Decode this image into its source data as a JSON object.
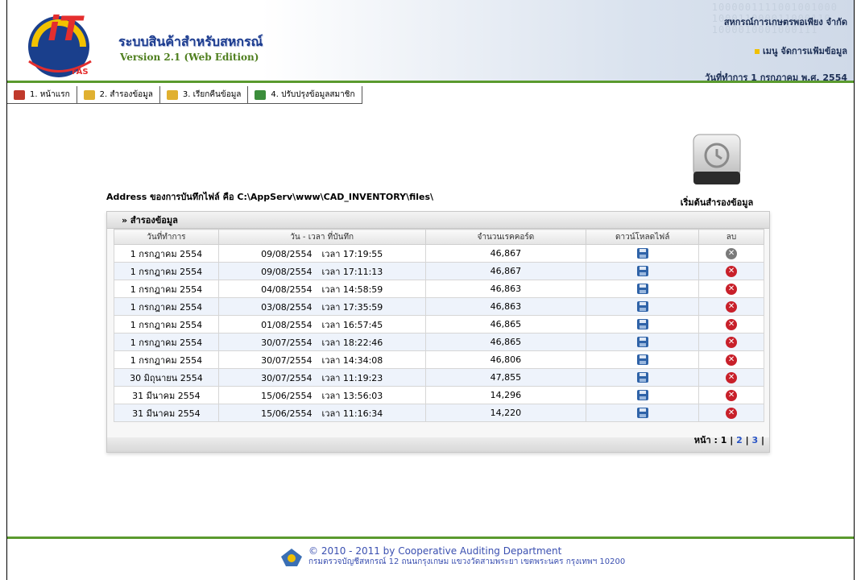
{
  "header": {
    "app_title": "ระบบสินค้าสำหรับสหกรณ์",
    "version": "Version 2.1 (Web Edition)",
    "coop_name": "สหกรณ์การเกษตรพอเพียง จำกัด",
    "user_line": "เมนู จัดการแฟ้มข้อมูล",
    "work_date": "วันที่ทำการ 1 กรกฎาคม พ.ศ. 2554",
    "faint_text": "1000001111001001000\n100011000011000110\n1000010001000111"
  },
  "menu": [
    {
      "label": "1. หน้าแรก",
      "icon": "home-icon",
      "color": "#c0392b"
    },
    {
      "label": "2. สำรองข้อมูล",
      "icon": "backup-icon",
      "color": "#e0b030"
    },
    {
      "label": "3. เรียกคืนข้อมูล",
      "icon": "restore-icon",
      "color": "#e0b030"
    },
    {
      "label": "4. ปรับปรุงข้อมูลสมาชิก",
      "icon": "members-icon",
      "color": "#3b8d3b"
    }
  ],
  "backup_button": {
    "label": "เริ่มต้นสำรองข้อมูล"
  },
  "address_line": "Address ของการบันทึกไฟล์ คือ C:\\AppServ\\www\\CAD_INVENTORY\\files\\",
  "panel": {
    "title": "» สำรองข้อมูล",
    "columns": [
      "วันที่ทำการ",
      "วัน - เวลา ที่บันทึก",
      "จำนวนเรคคอร์ด",
      "ดาวน์โหลดไฟล์",
      "ลบ"
    ],
    "rows": [
      {
        "work_date": "1 กรกฎาคม 2554",
        "saved_date": "09/08/2554",
        "saved_time": "เวลา 17:19:55",
        "records": "46,867",
        "delete_disabled": true
      },
      {
        "work_date": "1 กรกฎาคม 2554",
        "saved_date": "09/08/2554",
        "saved_time": "เวลา 17:11:13",
        "records": "46,867",
        "delete_disabled": false
      },
      {
        "work_date": "1 กรกฎาคม 2554",
        "saved_date": "04/08/2554",
        "saved_time": "เวลา 14:58:59",
        "records": "46,863",
        "delete_disabled": false
      },
      {
        "work_date": "1 กรกฎาคม 2554",
        "saved_date": "03/08/2554",
        "saved_time": "เวลา 17:35:59",
        "records": "46,863",
        "delete_disabled": false
      },
      {
        "work_date": "1 กรกฎาคม 2554",
        "saved_date": "01/08/2554",
        "saved_time": "เวลา 16:57:45",
        "records": "46,865",
        "delete_disabled": false
      },
      {
        "work_date": "1 กรกฎาคม 2554",
        "saved_date": "30/07/2554",
        "saved_time": "เวลา 18:22:46",
        "records": "46,865",
        "delete_disabled": false
      },
      {
        "work_date": "1 กรกฎาคม 2554",
        "saved_date": "30/07/2554",
        "saved_time": "เวลา 14:34:08",
        "records": "46,806",
        "delete_disabled": false
      },
      {
        "work_date": "30 มิถุนายน 2554",
        "saved_date": "30/07/2554",
        "saved_time": "เวลา 11:19:23",
        "records": "47,855",
        "delete_disabled": false
      },
      {
        "work_date": "31 มีนาคม 2554",
        "saved_date": "15/06/2554",
        "saved_time": "เวลา 13:56:03",
        "records": "14,296",
        "delete_disabled": false
      },
      {
        "work_date": "31 มีนาคม 2554",
        "saved_date": "15/06/2554",
        "saved_time": "เวลา 11:16:34",
        "records": "14,220",
        "delete_disabled": false
      }
    ],
    "pager": {
      "label": "หน้า : 1 |",
      "pages": [
        "2",
        "3"
      ],
      "sep": "|"
    }
  },
  "footer": {
    "copyright": "© 2010 - 2011  by Cooperative Auditing Department",
    "address": "กรมตรวจบัญชีสหกรณ์ 12 ถนนกรุงเกษม แขวงวัดสามพระยา เขตพระนคร กรุงเทพฯ 10200"
  }
}
